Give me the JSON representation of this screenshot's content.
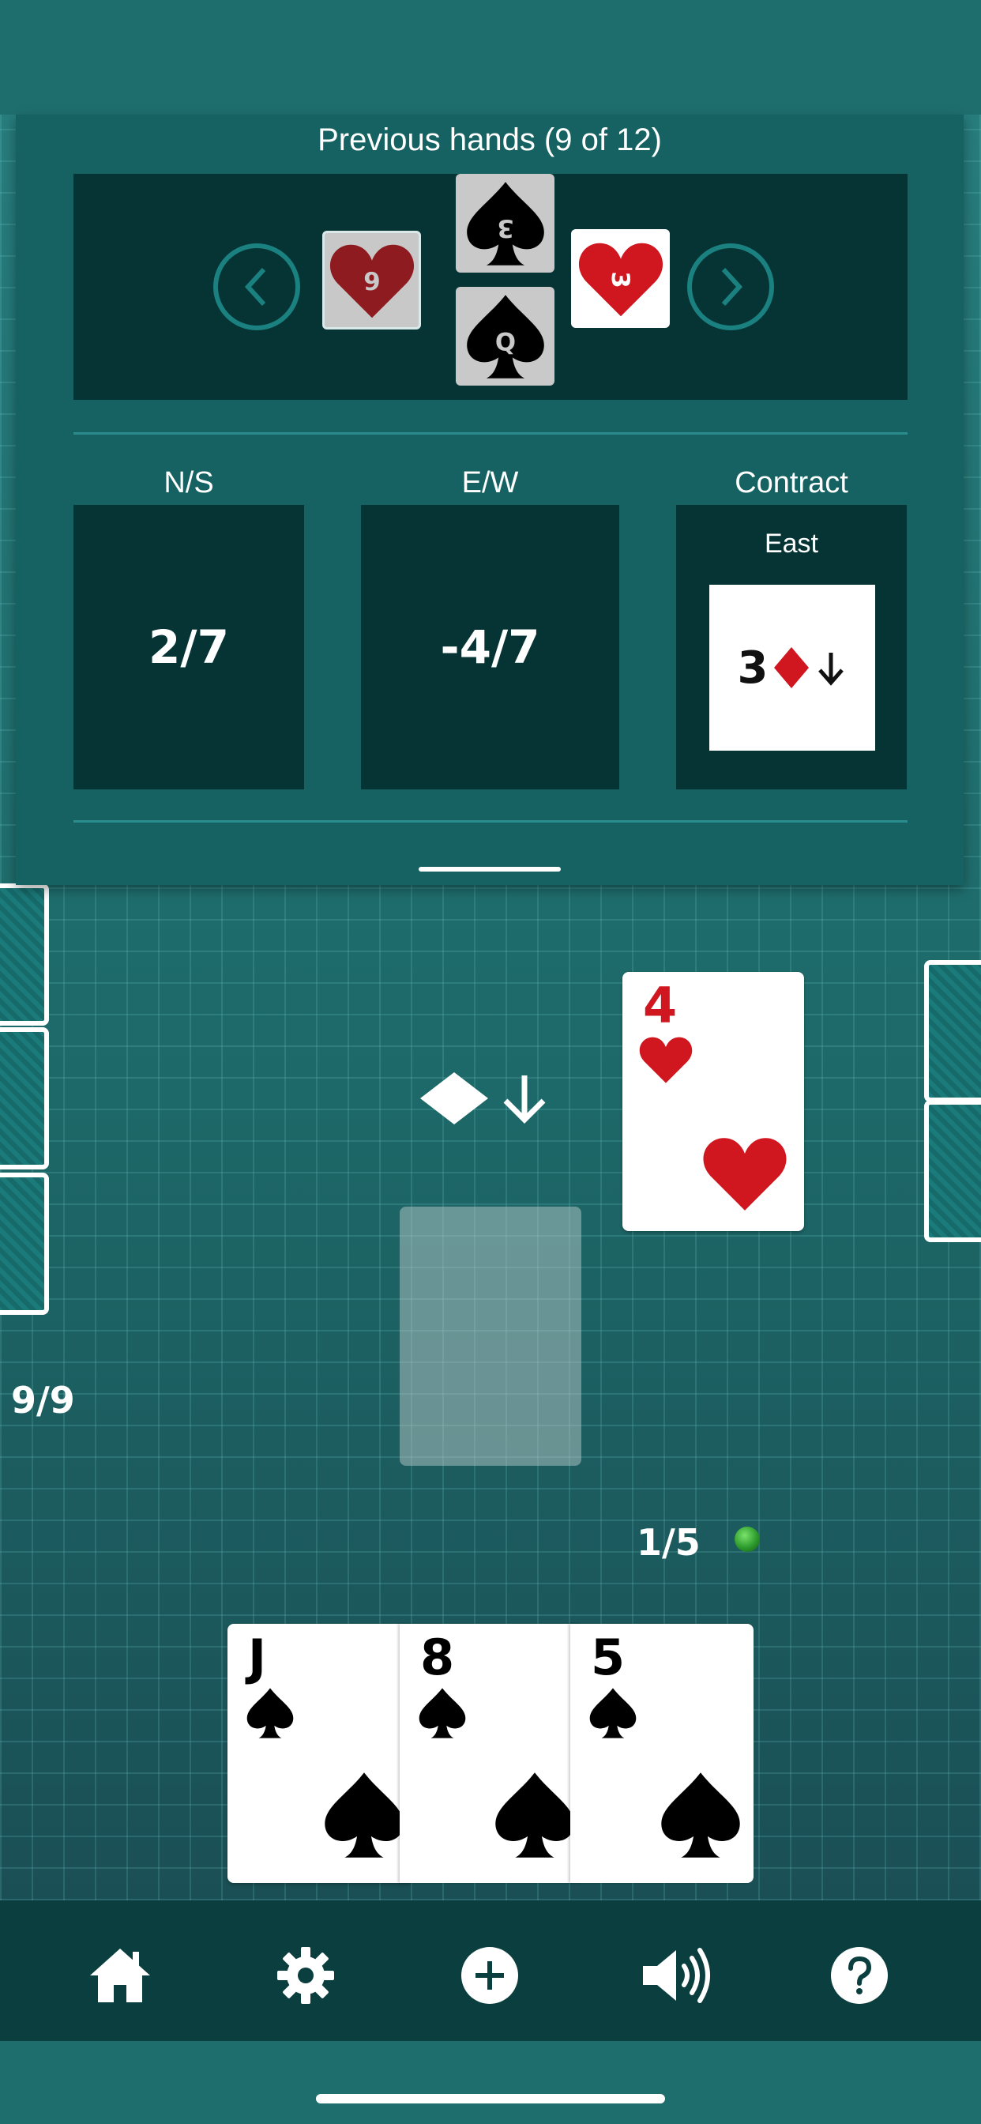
{
  "previous_hands": {
    "title": "Previous hands (9 of 12)",
    "trick": {
      "west": {
        "rank": "9",
        "suit": "hearts"
      },
      "north": {
        "rank": "3",
        "suit": "spades"
      },
      "south": {
        "rank": "Q",
        "suit": "spades"
      },
      "east": {
        "rank": "3",
        "suit": "hearts"
      }
    },
    "ns_label": "N/S",
    "ew_label": "E/W",
    "contract_label": "Contract",
    "ns_score": "2/7",
    "ew_score": "-4/7",
    "contract_seat": "East",
    "contract_level": "3",
    "contract_suit": "diamonds"
  },
  "table": {
    "west_tricks": "9/9",
    "south_tricks": "1/5",
    "east_played_card": {
      "rank": "4",
      "suit": "hearts"
    },
    "hand": [
      {
        "rank": "J",
        "suit": "spades"
      },
      {
        "rank": "8",
        "suit": "spades"
      },
      {
        "rank": "5",
        "suit": "spades"
      }
    ]
  },
  "toolbar": {
    "items": [
      "home-icon",
      "settings-icon",
      "new-game-icon",
      "sound-icon",
      "help-icon"
    ]
  },
  "colors": {
    "table": "#1e6a6a",
    "panel": "#166262",
    "panel_inner": "#063434",
    "red_suit": "#d0161e",
    "toolbar": "#0b3e3e"
  }
}
